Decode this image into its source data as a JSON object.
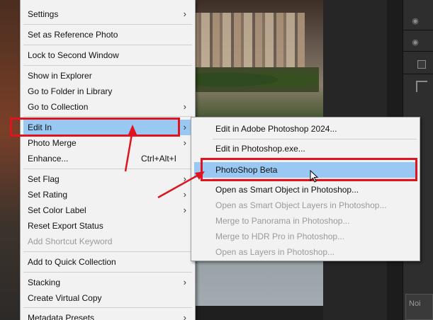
{
  "main_menu": {
    "items": [
      {
        "label": "Settings",
        "submenu": true
      },
      {
        "label": "Set as Reference Photo"
      },
      {
        "label": "Lock to Second Window"
      },
      {
        "label": "Show in Explorer"
      },
      {
        "label": "Go to Folder in Library"
      },
      {
        "label": "Go to Collection",
        "submenu": true
      },
      {
        "label": "Edit In",
        "submenu": true,
        "highlighted": true
      },
      {
        "label": "Photo Merge",
        "submenu": true
      },
      {
        "label": "Enhance...",
        "shortcut": "Ctrl+Alt+I"
      },
      {
        "label": "Set Flag",
        "submenu": true
      },
      {
        "label": "Set Rating",
        "submenu": true
      },
      {
        "label": "Set Color Label",
        "submenu": true
      },
      {
        "label": "Reset Export Status"
      },
      {
        "label": "Add Shortcut Keyword",
        "disabled": true
      },
      {
        "label": "Add to Quick Collection"
      },
      {
        "label": "Stacking",
        "submenu": true
      },
      {
        "label": "Create Virtual Copy"
      },
      {
        "label": "Metadata Presets",
        "submenu": true
      }
    ]
  },
  "sub_menu": {
    "items": [
      {
        "label": "Edit in Adobe Photoshop 2024..."
      },
      {
        "label": "Edit in Photoshop.exe..."
      },
      {
        "label": "PhotoShop Beta",
        "highlighted": true
      },
      {
        "label": "Open as Smart Object in Photoshop..."
      },
      {
        "label": "Open as Smart Object Layers in Photoshop...",
        "disabled": true
      },
      {
        "label": "Merge to Panorama in Photoshop...",
        "disabled": true
      },
      {
        "label": "Merge to HDR Pro in Photoshop...",
        "disabled": true
      },
      {
        "label": "Open as Layers in Photoshop...",
        "disabled": true
      }
    ]
  },
  "right_panel": {
    "noise_label": "Noi"
  },
  "colors": {
    "highlight": "#99c9f2",
    "annotation_red": "#e0141e",
    "menu_bg": "#f2f2f2"
  },
  "icons": {
    "submenu_arrow": "chevron-right-icon",
    "visibility": "eye-icon",
    "cursor": "mouse-pointer-icon"
  }
}
